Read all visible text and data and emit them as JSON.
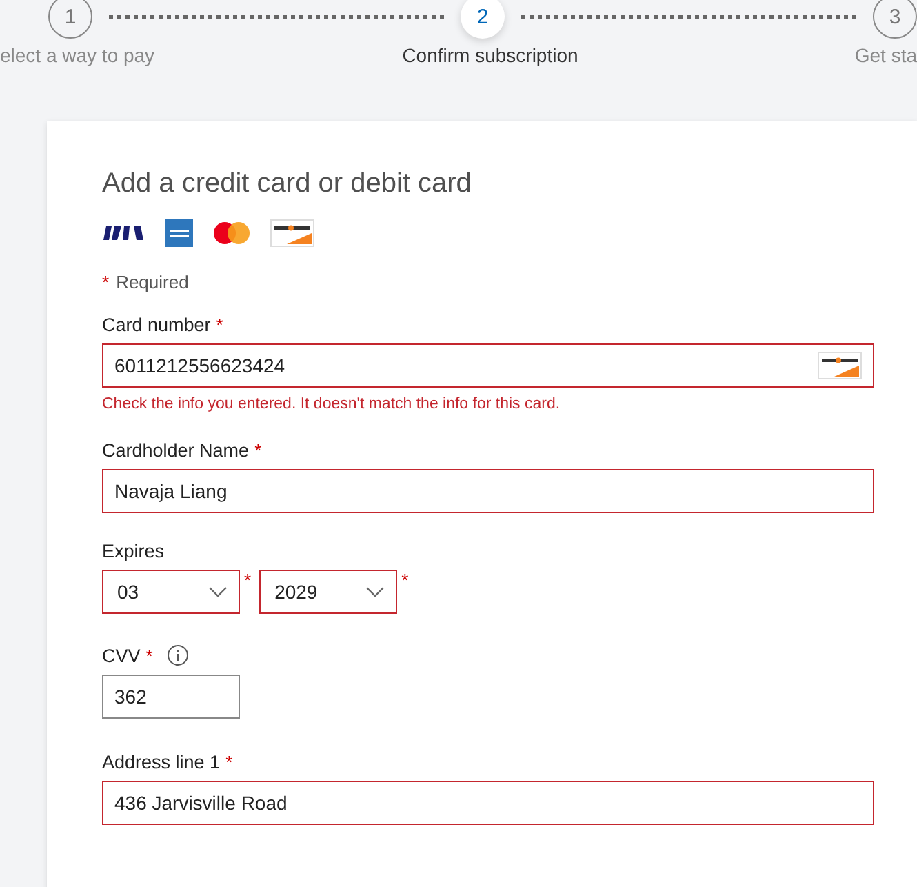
{
  "stepper": [
    {
      "number": "1",
      "label": "elect a way to pay",
      "selected": false
    },
    {
      "number": "2",
      "label": "Confirm subscription",
      "selected": true
    },
    {
      "number": "3",
      "label": "Get sta",
      "selected": false
    }
  ],
  "form": {
    "title": "Add a credit card or debit card",
    "required_note": {
      "mark": "*",
      "text": "Required"
    },
    "card_number": {
      "label": "Card number",
      "required": true,
      "required_mark": "*",
      "value": "6011212556623424",
      "invalid": true,
      "error": "Check the info you entered. It doesn't match the info for this card."
    },
    "cardholder_name": {
      "label": "Cardholder Name",
      "required": true,
      "required_mark": "*",
      "value": "Navaja Liang",
      "invalid": true
    },
    "expires": {
      "label": "Expires",
      "month": {
        "value": "03",
        "required": true,
        "required_mark": "*",
        "invalid": true
      },
      "year": {
        "value": "2029",
        "required": true,
        "required_mark": "*",
        "invalid": true
      }
    },
    "cvv": {
      "label": "CVV",
      "required": true,
      "required_mark": "*",
      "value": "362",
      "invalid": false
    },
    "address_line_1": {
      "label": "Address line 1",
      "required": true,
      "required_mark": "*",
      "value": "436  Jarvisville Road",
      "invalid": true
    }
  }
}
